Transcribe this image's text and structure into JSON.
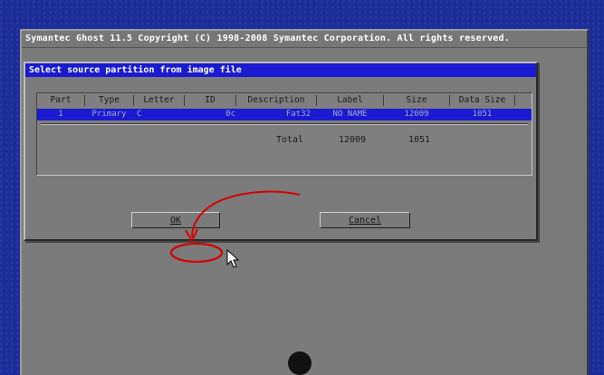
{
  "app_title": "Symantec Ghost 11.5   Copyright (C) 1998-2008 Symantec Corporation. All rights reserved.",
  "dialog": {
    "title": "Select source partition from image file",
    "columns": [
      "Part",
      "Type",
      "Letter",
      "ID",
      "Description",
      "Label",
      "Size",
      "Data Size"
    ],
    "row": {
      "part": "1",
      "type": "Primary",
      "letter": "C",
      "id": "0c",
      "description": "Fat32",
      "label": "NO NAME",
      "size": "12009",
      "data_size": "1051"
    },
    "total": {
      "label": "Total",
      "size": "12009",
      "data_size": "1051"
    },
    "ok_label": "OK",
    "cancel_label": "Cancel"
  },
  "colors": {
    "desktop": "#1c2d9a",
    "window": "#7b7b7b",
    "selection": "#1a1ad0",
    "annotation": "#d40000"
  }
}
